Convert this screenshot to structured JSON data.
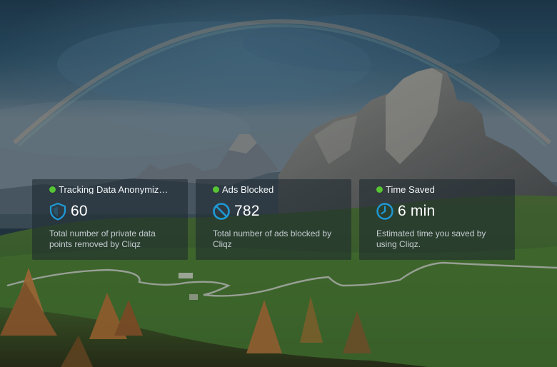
{
  "stats": [
    {
      "title": "Tracking Data Anonymiz…",
      "value": "60",
      "description": "Total number of private data points removed by Cliqz",
      "icon": "shield-icon",
      "status": "active"
    },
    {
      "title": "Ads Blocked",
      "value": "782",
      "description": "Total number of ads blocked by Cliqz",
      "icon": "block-icon",
      "status": "active"
    },
    {
      "title": "Time Saved",
      "value": "6 min",
      "description": "Estimated time you saved by using Cliqz.",
      "icon": "clock-icon",
      "status": "active"
    }
  ],
  "colors": {
    "accent": "#1e9ad8",
    "status_active": "#57c533"
  }
}
